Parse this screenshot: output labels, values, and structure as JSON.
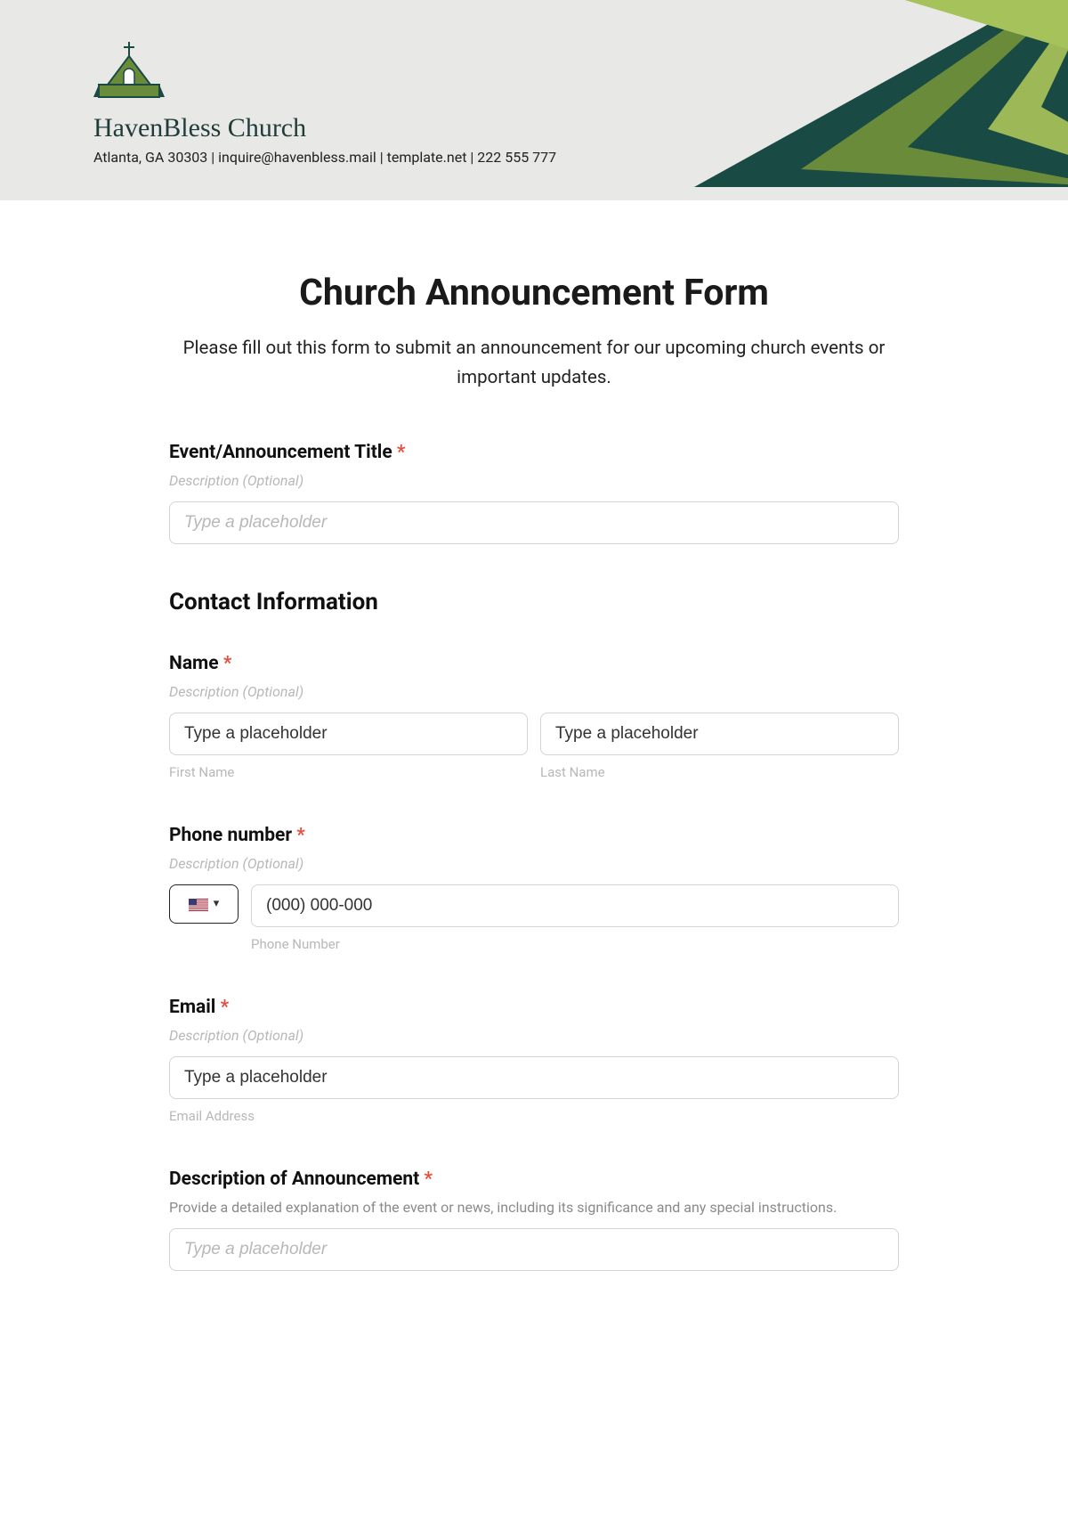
{
  "header": {
    "church_name": "HavenBless Church",
    "contact_line": "Atlanta, GA 30303 | inquire@havenbless.mail | template.net | 222 555 777"
  },
  "form": {
    "title": "Church Announcement Form",
    "subtitle": "Please fill out this form to submit an announcement for our upcoming church events or important updates.",
    "desc_optional": "Description (Optional)",
    "placeholder": "Type a placeholder",
    "required_mark": "*",
    "event_title": {
      "label": "Event/Announcement Title "
    },
    "contact_section": "Contact Information",
    "name": {
      "label": "Name ",
      "first_sub": "First Name",
      "last_sub": "Last Name"
    },
    "phone": {
      "label": "Phone number ",
      "placeholder": "(000) 000-000",
      "sub": "Phone Number"
    },
    "email": {
      "label": "Email ",
      "sub": "Email Address"
    },
    "description": {
      "label": "Description of Announcement ",
      "desc": "Provide a detailed explanation of the event or news, including its significance and any special instructions."
    }
  }
}
